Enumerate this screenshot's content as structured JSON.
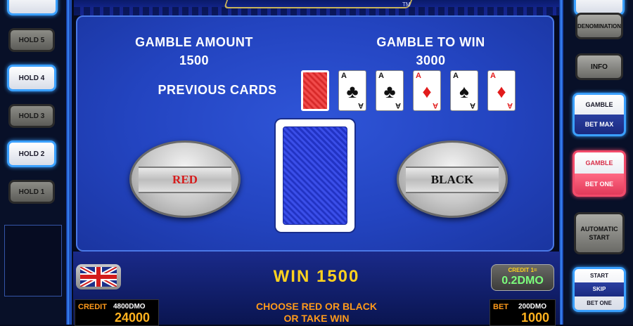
{
  "gamble_amount": {
    "label": "GAMBLE AMOUNT",
    "value": "1500"
  },
  "gamble_to_win": {
    "label": "GAMBLE TO WIN",
    "value": "3000"
  },
  "previous_cards": {
    "label": "PREVIOUS CARDS",
    "cards": [
      {
        "rank": "",
        "suit": "back",
        "color": "red"
      },
      {
        "rank": "A",
        "suit": "♣",
        "color": "black"
      },
      {
        "rank": "A",
        "suit": "♣",
        "color": "black"
      },
      {
        "rank": "A",
        "suit": "♦",
        "color": "red"
      },
      {
        "rank": "A",
        "suit": "♠",
        "color": "black"
      },
      {
        "rank": "A",
        "suit": "♦",
        "color": "red"
      }
    ]
  },
  "buttons": {
    "red": "RED",
    "black": "BLACK"
  },
  "trademark": "TM",
  "win": {
    "label": "WIN",
    "value": "1500"
  },
  "credit": {
    "label": "CREDIT",
    "sub": "4800DMO",
    "value": "24000"
  },
  "bet": {
    "label": "BET",
    "sub": "200DMO",
    "value": "1000"
  },
  "denomination_box": {
    "caption": "CREDIT 1=",
    "value": "0.2DMO"
  },
  "message": {
    "line1": "CHOOSE RED OR BLACK",
    "line2": "OR TAKE WIN"
  },
  "hold_buttons": [
    {
      "label": "HOLD 5",
      "state": "off"
    },
    {
      "label": "HOLD 4",
      "state": "on"
    },
    {
      "label": "HOLD 3",
      "state": "off"
    },
    {
      "label": "HOLD 2",
      "state": "on"
    },
    {
      "label": "HOLD 1",
      "state": "off"
    }
  ],
  "right_buttons": {
    "denomination": "DENOMINATION",
    "info": "INFO",
    "gamble_bet_max": {
      "top": "GAMBLE",
      "bottom": "BET MAX"
    },
    "gamble_bet_one": {
      "top": "GAMBLE",
      "bottom": "BET ONE"
    },
    "automatic_start": {
      "line1": "AUTOMATIC",
      "line2": "START"
    },
    "start_skip_bet_one": {
      "top": "START",
      "middle": "SKIP",
      "bottom": "BET ONE"
    }
  },
  "colors": {
    "felt": "#2344c0",
    "win_text": "#ffd21e",
    "accent_orange": "#ff9a1a",
    "neon_blue": "#3aa0ff",
    "gamble_pink": "#f24a6a"
  },
  "flag_icon": "uk-flag-icon"
}
